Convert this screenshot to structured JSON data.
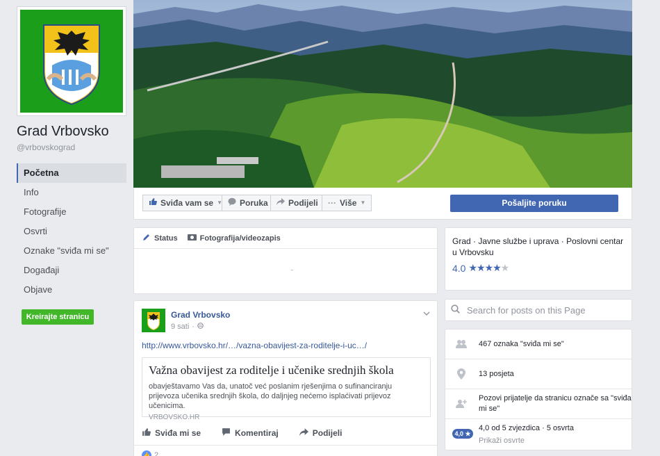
{
  "page": {
    "name": "Grad Vrbovsko",
    "handle": "@vrbovskograd"
  },
  "sidebar": {
    "items": [
      {
        "label": "Početna"
      },
      {
        "label": "Info"
      },
      {
        "label": "Fotografije"
      },
      {
        "label": "Osvrti"
      },
      {
        "label": "Oznake \"sviđa mi se\""
      },
      {
        "label": "Događaji"
      },
      {
        "label": "Objave"
      }
    ],
    "create_label": "Kreirajte stranicu"
  },
  "actionbar": {
    "like_label": "Sviđa vam se",
    "message_label": "Poruka",
    "share_label": "Podijeli",
    "more_label": "Više",
    "send_message_label": "Pošaljite poruku"
  },
  "composer": {
    "status_label": "Status",
    "photo_label": "Fotografija/videozapis"
  },
  "post": {
    "author": "Grad Vrbovsko",
    "time": "9 sati",
    "link_text": "http://www.vrbovsko.hr/…/vazna-obavijest-za-roditelje-i-uc…/",
    "card_title": "Važna obavijest za roditelje i učenike srednjih škola",
    "card_desc": "obavještavamo Vas da, unatoč već poslanim rješenjima o sufinanciranju prijevoza učenika srednjih škola, do daljnjeg nećemo isplaćivati prijevoz učenicima.",
    "card_source": "VRBOVSKO.HR",
    "like_label": "Sviđa mi se",
    "comment_label": "Komentiraj",
    "share_label": "Podijeli",
    "like_count": "2"
  },
  "about": {
    "categories": "Grad · Javne službe i uprava · Poslovni centar",
    "location": "u Vrbovsku",
    "rating": "4.0",
    "stars_filled": 4,
    "stars_total": 5
  },
  "search": {
    "placeholder": "Search for posts on this Page"
  },
  "stats": {
    "likes": "467 oznaka \"sviđa mi se\"",
    "visits": "13 posjeta",
    "invite": "Pozovi prijatelje da stranicu označe sa \"sviđa mi se\"",
    "rating_badge": "4,0 ★",
    "rating_text": "4,0 od 5 zvjezdica · 5 osvrta",
    "reviews_link": "Prikaži osvrte"
  },
  "colors": {
    "brand_blue": "#4267b2",
    "link_blue": "#365899",
    "create_green": "#42b72a",
    "logo_green": "#1b9f1b"
  }
}
